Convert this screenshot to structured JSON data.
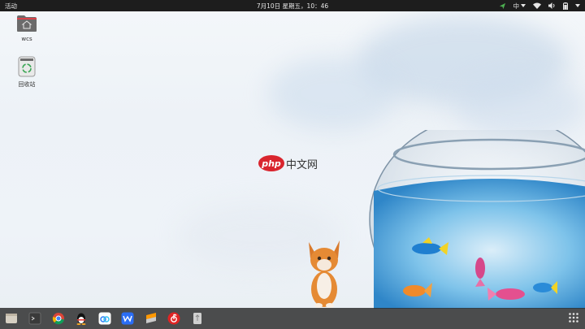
{
  "topbar": {
    "activities": "活动",
    "clock": "7月10日 星期五，10：46",
    "input_method": "中",
    "icons": [
      "send-arrow-icon",
      "chevron-down-icon",
      "wifi-icon",
      "volume-icon",
      "battery-icon",
      "power-icon"
    ]
  },
  "desktop": {
    "home_folder": {
      "label": "wcs",
      "icon": "home-folder-icon"
    },
    "trash": {
      "label": "回收站",
      "icon": "trash-icon"
    }
  },
  "wallpaper": {
    "logo_latin": "php",
    "logo_chinese": "中文网"
  },
  "dock": {
    "items": [
      "files-icon",
      "terminal-icon",
      "chrome-icon",
      "qq-icon",
      "baidu-netdisk-icon",
      "wps-icon",
      "sublime-icon",
      "netease-music-icon",
      "usb-drive-icon"
    ],
    "apps_grid_icon": "show-apps-icon"
  },
  "colors": {
    "topbar_bg": "#1d1d1d",
    "dock_bg": "#282828",
    "accent_green": "#4caf50",
    "logo_red": "#d9252e"
  }
}
